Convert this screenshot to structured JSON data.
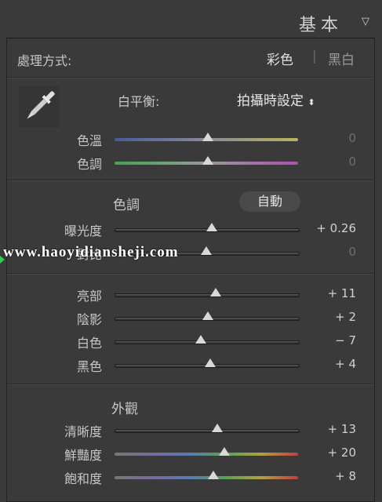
{
  "header": {
    "title": "基本",
    "collapse_icon": "triangle-down-icon"
  },
  "treatment": {
    "label": "處理方式:",
    "color": "彩色",
    "separator": "|",
    "bw": "黑白"
  },
  "white_balance": {
    "label": "白平衡:",
    "value": "拍攝時設定",
    "dropdown_icon": "updown-arrow-icon",
    "eyedropper_icon": "eyedropper-icon"
  },
  "wb_sliders": [
    {
      "label": "色溫",
      "value": "0",
      "position": 0.51
    },
    {
      "label": "色調",
      "value": "0",
      "position": 0.51
    }
  ],
  "tone": {
    "heading": "色調",
    "auto": "自動"
  },
  "exposure": {
    "label": "曝光度",
    "value": "+ 0.26",
    "position": 0.53
  },
  "contrast": {
    "label": "對比",
    "value": "0",
    "position": 0.5
  },
  "tone_sliders": [
    {
      "label": "亮部",
      "value": "+ 11",
      "position": 0.55
    },
    {
      "label": "陰影",
      "value": "+ 2",
      "position": 0.51
    },
    {
      "label": "白色",
      "value": "− 7",
      "position": 0.47
    },
    {
      "label": "黑色",
      "value": "+ 4",
      "position": 0.52
    }
  ],
  "presence": {
    "heading": "外觀"
  },
  "presence_sliders": [
    {
      "label": "清晰度",
      "value": "+ 13",
      "position": 0.56
    },
    {
      "label": "鮮豔度",
      "value": "+ 20",
      "position": 0.6
    },
    {
      "label": "飽和度",
      "value": "+ 8",
      "position": 0.54
    }
  ],
  "watermark": "www.haoyidiansheji.com"
}
